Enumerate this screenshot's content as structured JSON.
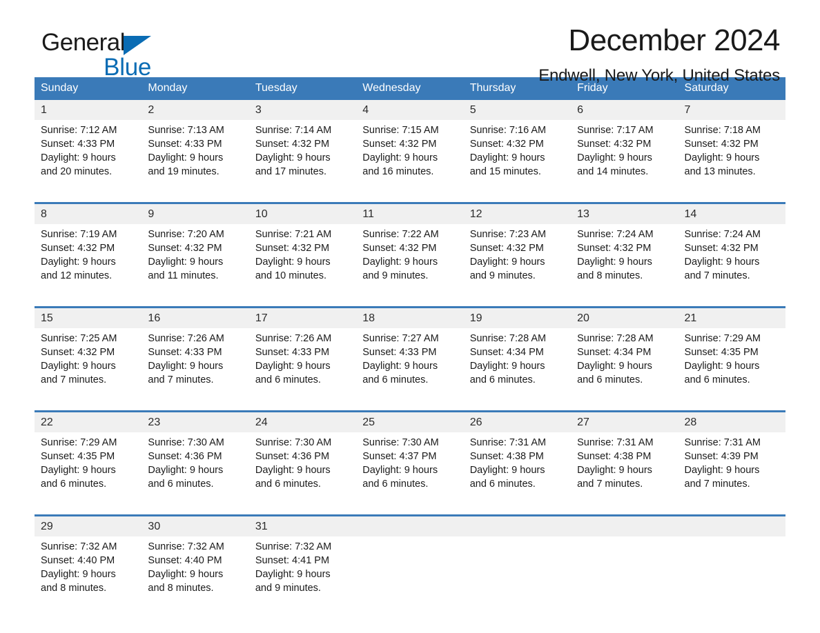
{
  "brand": {
    "word1": "General",
    "word2": "Blue",
    "flag_icon": "triangle-flag-icon",
    "accent_color": "#0a6cb4"
  },
  "header": {
    "month_title": "December 2024",
    "location": "Endwell, New York, United States"
  },
  "calendar": {
    "header_color": "#3a7ab8",
    "daynum_band_color": "#f0f0f0",
    "weekdays": [
      "Sunday",
      "Monday",
      "Tuesday",
      "Wednesday",
      "Thursday",
      "Friday",
      "Saturday"
    ],
    "weeks": [
      [
        {
          "day": "1",
          "sunrise": "Sunrise: 7:12 AM",
          "sunset": "Sunset: 4:33 PM",
          "daylight1": "Daylight: 9 hours",
          "daylight2": "and 20 minutes."
        },
        {
          "day": "2",
          "sunrise": "Sunrise: 7:13 AM",
          "sunset": "Sunset: 4:33 PM",
          "daylight1": "Daylight: 9 hours",
          "daylight2": "and 19 minutes."
        },
        {
          "day": "3",
          "sunrise": "Sunrise: 7:14 AM",
          "sunset": "Sunset: 4:32 PM",
          "daylight1": "Daylight: 9 hours",
          "daylight2": "and 17 minutes."
        },
        {
          "day": "4",
          "sunrise": "Sunrise: 7:15 AM",
          "sunset": "Sunset: 4:32 PM",
          "daylight1": "Daylight: 9 hours",
          "daylight2": "and 16 minutes."
        },
        {
          "day": "5",
          "sunrise": "Sunrise: 7:16 AM",
          "sunset": "Sunset: 4:32 PM",
          "daylight1": "Daylight: 9 hours",
          "daylight2": "and 15 minutes."
        },
        {
          "day": "6",
          "sunrise": "Sunrise: 7:17 AM",
          "sunset": "Sunset: 4:32 PM",
          "daylight1": "Daylight: 9 hours",
          "daylight2": "and 14 minutes."
        },
        {
          "day": "7",
          "sunrise": "Sunrise: 7:18 AM",
          "sunset": "Sunset: 4:32 PM",
          "daylight1": "Daylight: 9 hours",
          "daylight2": "and 13 minutes."
        }
      ],
      [
        {
          "day": "8",
          "sunrise": "Sunrise: 7:19 AM",
          "sunset": "Sunset: 4:32 PM",
          "daylight1": "Daylight: 9 hours",
          "daylight2": "and 12 minutes."
        },
        {
          "day": "9",
          "sunrise": "Sunrise: 7:20 AM",
          "sunset": "Sunset: 4:32 PM",
          "daylight1": "Daylight: 9 hours",
          "daylight2": "and 11 minutes."
        },
        {
          "day": "10",
          "sunrise": "Sunrise: 7:21 AM",
          "sunset": "Sunset: 4:32 PM",
          "daylight1": "Daylight: 9 hours",
          "daylight2": "and 10 minutes."
        },
        {
          "day": "11",
          "sunrise": "Sunrise: 7:22 AM",
          "sunset": "Sunset: 4:32 PM",
          "daylight1": "Daylight: 9 hours",
          "daylight2": "and 9 minutes."
        },
        {
          "day": "12",
          "sunrise": "Sunrise: 7:23 AM",
          "sunset": "Sunset: 4:32 PM",
          "daylight1": "Daylight: 9 hours",
          "daylight2": "and 9 minutes."
        },
        {
          "day": "13",
          "sunrise": "Sunrise: 7:24 AM",
          "sunset": "Sunset: 4:32 PM",
          "daylight1": "Daylight: 9 hours",
          "daylight2": "and 8 minutes."
        },
        {
          "day": "14",
          "sunrise": "Sunrise: 7:24 AM",
          "sunset": "Sunset: 4:32 PM",
          "daylight1": "Daylight: 9 hours",
          "daylight2": "and 7 minutes."
        }
      ],
      [
        {
          "day": "15",
          "sunrise": "Sunrise: 7:25 AM",
          "sunset": "Sunset: 4:32 PM",
          "daylight1": "Daylight: 9 hours",
          "daylight2": "and 7 minutes."
        },
        {
          "day": "16",
          "sunrise": "Sunrise: 7:26 AM",
          "sunset": "Sunset: 4:33 PM",
          "daylight1": "Daylight: 9 hours",
          "daylight2": "and 7 minutes."
        },
        {
          "day": "17",
          "sunrise": "Sunrise: 7:26 AM",
          "sunset": "Sunset: 4:33 PM",
          "daylight1": "Daylight: 9 hours",
          "daylight2": "and 6 minutes."
        },
        {
          "day": "18",
          "sunrise": "Sunrise: 7:27 AM",
          "sunset": "Sunset: 4:33 PM",
          "daylight1": "Daylight: 9 hours",
          "daylight2": "and 6 minutes."
        },
        {
          "day": "19",
          "sunrise": "Sunrise: 7:28 AM",
          "sunset": "Sunset: 4:34 PM",
          "daylight1": "Daylight: 9 hours",
          "daylight2": "and 6 minutes."
        },
        {
          "day": "20",
          "sunrise": "Sunrise: 7:28 AM",
          "sunset": "Sunset: 4:34 PM",
          "daylight1": "Daylight: 9 hours",
          "daylight2": "and 6 minutes."
        },
        {
          "day": "21",
          "sunrise": "Sunrise: 7:29 AM",
          "sunset": "Sunset: 4:35 PM",
          "daylight1": "Daylight: 9 hours",
          "daylight2": "and 6 minutes."
        }
      ],
      [
        {
          "day": "22",
          "sunrise": "Sunrise: 7:29 AM",
          "sunset": "Sunset: 4:35 PM",
          "daylight1": "Daylight: 9 hours",
          "daylight2": "and 6 minutes."
        },
        {
          "day": "23",
          "sunrise": "Sunrise: 7:30 AM",
          "sunset": "Sunset: 4:36 PM",
          "daylight1": "Daylight: 9 hours",
          "daylight2": "and 6 minutes."
        },
        {
          "day": "24",
          "sunrise": "Sunrise: 7:30 AM",
          "sunset": "Sunset: 4:36 PM",
          "daylight1": "Daylight: 9 hours",
          "daylight2": "and 6 minutes."
        },
        {
          "day": "25",
          "sunrise": "Sunrise: 7:30 AM",
          "sunset": "Sunset: 4:37 PM",
          "daylight1": "Daylight: 9 hours",
          "daylight2": "and 6 minutes."
        },
        {
          "day": "26",
          "sunrise": "Sunrise: 7:31 AM",
          "sunset": "Sunset: 4:38 PM",
          "daylight1": "Daylight: 9 hours",
          "daylight2": "and 6 minutes."
        },
        {
          "day": "27",
          "sunrise": "Sunrise: 7:31 AM",
          "sunset": "Sunset: 4:38 PM",
          "daylight1": "Daylight: 9 hours",
          "daylight2": "and 7 minutes."
        },
        {
          "day": "28",
          "sunrise": "Sunrise: 7:31 AM",
          "sunset": "Sunset: 4:39 PM",
          "daylight1": "Daylight: 9 hours",
          "daylight2": "and 7 minutes."
        }
      ],
      [
        {
          "day": "29",
          "sunrise": "Sunrise: 7:32 AM",
          "sunset": "Sunset: 4:40 PM",
          "daylight1": "Daylight: 9 hours",
          "daylight2": "and 8 minutes."
        },
        {
          "day": "30",
          "sunrise": "Sunrise: 7:32 AM",
          "sunset": "Sunset: 4:40 PM",
          "daylight1": "Daylight: 9 hours",
          "daylight2": "and 8 minutes."
        },
        {
          "day": "31",
          "sunrise": "Sunrise: 7:32 AM",
          "sunset": "Sunset: 4:41 PM",
          "daylight1": "Daylight: 9 hours",
          "daylight2": "and 9 minutes."
        },
        {
          "day": "",
          "sunrise": "",
          "sunset": "",
          "daylight1": "",
          "daylight2": ""
        },
        {
          "day": "",
          "sunrise": "",
          "sunset": "",
          "daylight1": "",
          "daylight2": ""
        },
        {
          "day": "",
          "sunrise": "",
          "sunset": "",
          "daylight1": "",
          "daylight2": ""
        },
        {
          "day": "",
          "sunrise": "",
          "sunset": "",
          "daylight1": "",
          "daylight2": ""
        }
      ]
    ]
  }
}
